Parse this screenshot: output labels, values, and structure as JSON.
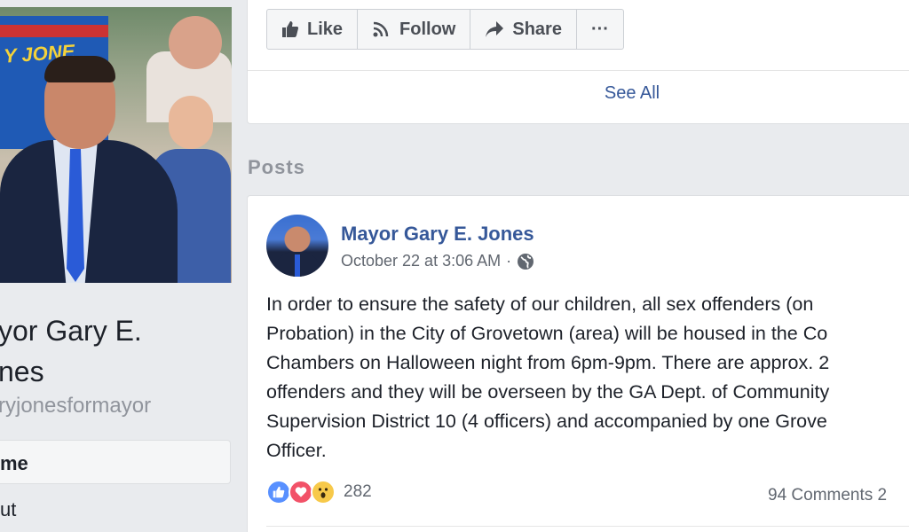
{
  "left": {
    "page_name": "yor Gary E.\nnes",
    "page_handle": "ryjonesformayor",
    "nav": {
      "home": "me",
      "about": "ut"
    },
    "sign_text": "Y JONE"
  },
  "actions": {
    "like": "Like",
    "follow": "Follow",
    "share": "Share",
    "more": "···"
  },
  "see_all": "See All",
  "posts_heading": "Posts",
  "post": {
    "author": "Mayor Gary E. Jones",
    "timestamp": "October 22 at 3:06 AM",
    "separator": "·",
    "privacy_icon": "globe-icon",
    "text": "In order to ensure the safety of our children, all sex offenders (on\nProbation) in the City of Grovetown (area) will be housed in the Co\nChambers on Halloween night from 6pm-9pm. There are approx. 2\noffenders and they will be overseen by the GA Dept. of Community\nSupervision District 10 (4 officers) and accompanied by one Grove\nOfficer.",
    "reaction_count": "282",
    "comments": "94 Comments  2"
  },
  "colors": {
    "link": "#365899",
    "muted": "#90949c",
    "like": "#5890ff",
    "love": "#f25268",
    "wow": "#f7c94a"
  }
}
